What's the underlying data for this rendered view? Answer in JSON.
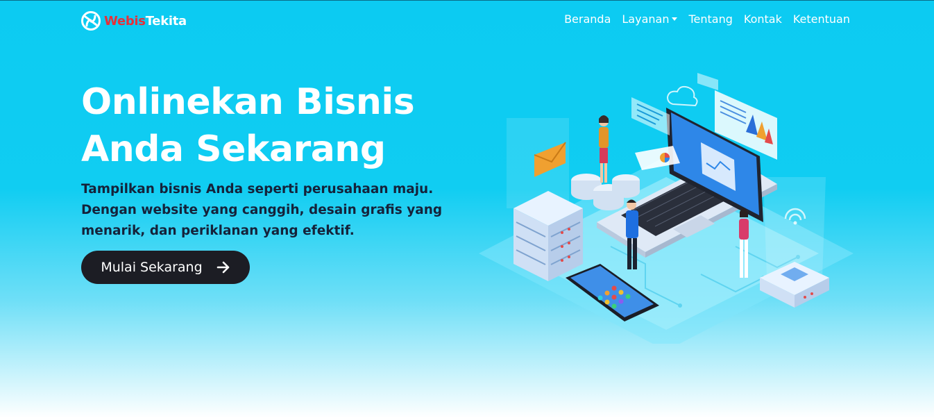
{
  "brand": {
    "name_part1": "Webis",
    "name_part2": "Tekita",
    "logo_icon": "brand-logo-icon",
    "accent_color": "#e6303a"
  },
  "nav": {
    "items": [
      {
        "label": "Beranda"
      },
      {
        "label": "Layanan",
        "has_dropdown": true
      },
      {
        "label": "Tentang"
      },
      {
        "label": "Kontak"
      },
      {
        "label": "Ketentuan"
      }
    ]
  },
  "hero": {
    "title_line1": "Onlinekan Bisnis",
    "title_line2": "Anda Sekarang",
    "desc_line1": "Tampilkan bisnis Anda seperti perusahaan maju.",
    "desc_line2": "Dengan website yang canggih, desain grafis yang",
    "desc_line3": "menarik, dan periklanan yang efektif.",
    "cta_label": "Mulai Sekarang",
    "cta_icon": "arrow-right-icon"
  },
  "colors": {
    "background": "#0ccbf2",
    "cta_background": "#1c1d24",
    "description_text": "#15223a"
  },
  "illustration": {
    "icon": "isometric-technology-illustration"
  }
}
